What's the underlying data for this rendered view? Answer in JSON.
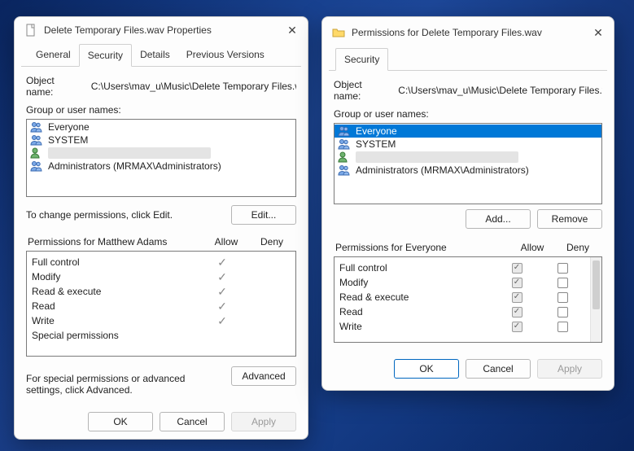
{
  "left_dialog": {
    "title": "Delete Temporary Files.wav Properties",
    "tabs": [
      "General",
      "Security",
      "Details",
      "Previous Versions"
    ],
    "active_tab": "Security",
    "object_name_label": "Object name:",
    "object_name_value": "C:\\Users\\mav_u\\Music\\Delete Temporary Files.wa",
    "group_label": "Group or user names:",
    "users": [
      {
        "name": "Everyone",
        "type": "group"
      },
      {
        "name": "SYSTEM",
        "type": "group"
      },
      {
        "name": "",
        "type": "user",
        "redacted": true
      },
      {
        "name": "Administrators (MRMAX\\Administrators)",
        "type": "group"
      }
    ],
    "change_perm_text": "To change permissions, click Edit.",
    "edit_btn": "Edit...",
    "perm_for_label_prefix": "Permissions for",
    "perm_for_user": "Matthew Adams",
    "allow_hdr": "Allow",
    "deny_hdr": "Deny",
    "permissions": [
      {
        "name": "Full control",
        "allow": true,
        "deny": false
      },
      {
        "name": "Modify",
        "allow": true,
        "deny": false
      },
      {
        "name": "Read & execute",
        "allow": true,
        "deny": false
      },
      {
        "name": "Read",
        "allow": true,
        "deny": false
      },
      {
        "name": "Write",
        "allow": true,
        "deny": false
      },
      {
        "name": "Special permissions",
        "allow": false,
        "deny": false
      }
    ],
    "advanced_text": "For special permissions or advanced settings, click Advanced.",
    "advanced_btn": "Advanced",
    "ok_btn": "OK",
    "cancel_btn": "Cancel",
    "apply_btn": "Apply"
  },
  "right_dialog": {
    "title": "Permissions for Delete Temporary Files.wav",
    "tabs": [
      "Security"
    ],
    "active_tab": "Security",
    "object_name_label": "Object name:",
    "object_name_value": "C:\\Users\\mav_u\\Music\\Delete Temporary Files.wa",
    "group_label": "Group or user names:",
    "users": [
      {
        "name": "Everyone",
        "type": "group",
        "selected": true
      },
      {
        "name": "SYSTEM",
        "type": "group"
      },
      {
        "name": "",
        "type": "user",
        "redacted": true
      },
      {
        "name": "Administrators (MRMAX\\Administrators)",
        "type": "group"
      }
    ],
    "add_btn": "Add...",
    "remove_btn": "Remove",
    "perm_for_label_prefix": "Permissions for",
    "perm_for_user": "Everyone",
    "allow_hdr": "Allow",
    "deny_hdr": "Deny",
    "permissions": [
      {
        "name": "Full control",
        "allow": true,
        "deny": false
      },
      {
        "name": "Modify",
        "allow": true,
        "deny": false
      },
      {
        "name": "Read & execute",
        "allow": true,
        "deny": false
      },
      {
        "name": "Read",
        "allow": true,
        "deny": false
      },
      {
        "name": "Write",
        "allow": true,
        "deny": false
      }
    ],
    "ok_btn": "OK",
    "cancel_btn": "Cancel",
    "apply_btn": "Apply"
  }
}
